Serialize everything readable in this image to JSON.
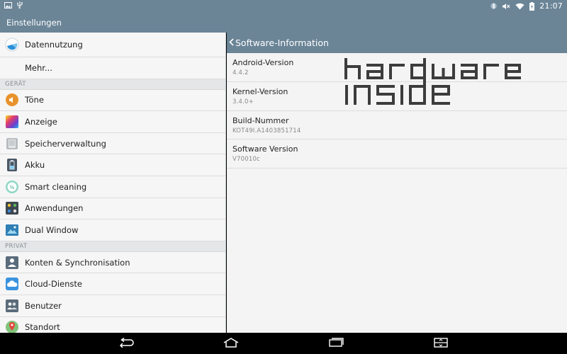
{
  "status_bar": {
    "time": "21:07"
  },
  "app": {
    "title": "Einstellungen"
  },
  "sidebar": {
    "items": [
      {
        "label": "Datennutzung",
        "icon": "data-usage-icon"
      },
      {
        "label": "Mehr...",
        "icon": ""
      }
    ],
    "sections": [
      {
        "header": "GERÄT",
        "items": [
          {
            "label": "Töne",
            "icon": "sound-icon"
          },
          {
            "label": "Anzeige",
            "icon": "display-icon"
          },
          {
            "label": "Speicherverwaltung",
            "icon": "storage-icon"
          },
          {
            "label": "Akku",
            "icon": "battery-icon"
          },
          {
            "label": "Smart cleaning",
            "icon": "smart-cleaning-icon"
          },
          {
            "label": "Anwendungen",
            "icon": "apps-icon"
          },
          {
            "label": "Dual Window",
            "icon": "dual-window-icon"
          }
        ]
      },
      {
        "header": "PRIVAT",
        "items": [
          {
            "label": "Konten & Synchronisation",
            "icon": "accounts-icon"
          },
          {
            "label": "Cloud-Dienste",
            "icon": "cloud-icon"
          },
          {
            "label": "Benutzer",
            "icon": "users-icon"
          },
          {
            "label": "Standort",
            "icon": "location-icon"
          }
        ]
      }
    ]
  },
  "detail": {
    "title": "Software-Information",
    "rows": [
      {
        "title": "Android-Version",
        "value": "4.4.2"
      },
      {
        "title": "Kernel-Version",
        "value": "3.4.0+"
      },
      {
        "title": "Build-Nummer",
        "value": "KOT49I.A1403851714"
      },
      {
        "title": "Software Version",
        "value": "V70010c"
      }
    ]
  },
  "watermark": {
    "line1": "hardware",
    "line2": "inside"
  },
  "colors": {
    "bar": "#6b8597",
    "pane_bg": "#f6f6f6",
    "divider": "#dcdcdc"
  }
}
